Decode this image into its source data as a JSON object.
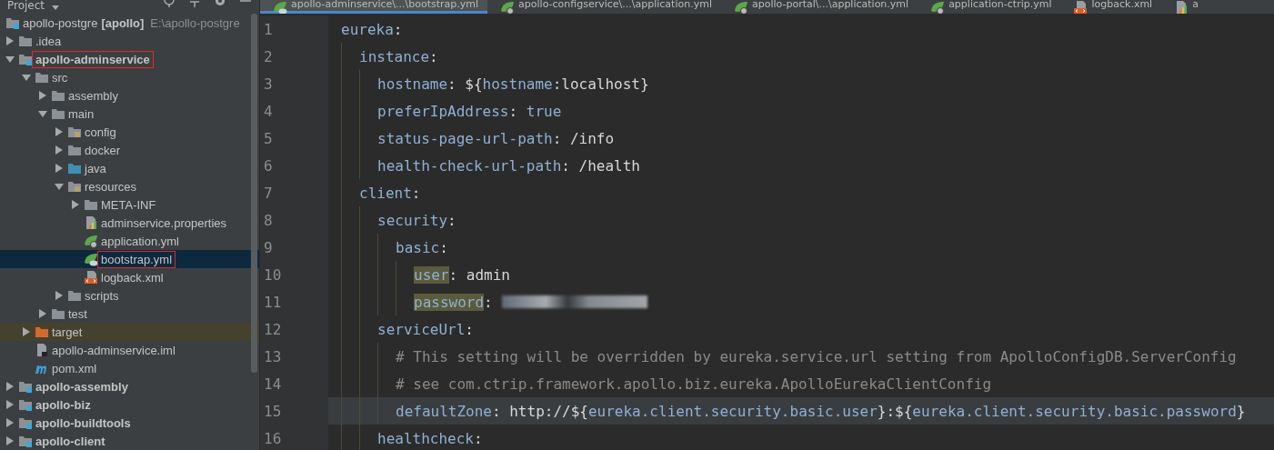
{
  "project_panel": {
    "title": "Project",
    "root": {
      "label": "apollo-postgre",
      "module": "[apollo]",
      "path": "E:\\apollo-postgre",
      "kind": "project",
      "selected": false,
      "marked": false,
      "children": [
        {
          "label": ".idea",
          "kind": "folder",
          "expanded": false,
          "selected": false,
          "marked": false
        },
        {
          "label": "apollo-adminservice",
          "kind": "module",
          "expanded": true,
          "selected": false,
          "marked": true,
          "children": [
            {
              "label": "src",
              "kind": "folder",
              "expanded": true,
              "selected": false,
              "marked": false,
              "children": [
                {
                  "label": "assembly",
                  "kind": "folder",
                  "expanded": false,
                  "selected": false,
                  "marked": false
                },
                {
                  "label": "main",
                  "kind": "folder",
                  "expanded": true,
                  "selected": false,
                  "marked": false,
                  "children": [
                    {
                      "label": "config",
                      "kind": "resource-folder",
                      "expanded": false,
                      "selected": false,
                      "marked": false
                    },
                    {
                      "label": "docker",
                      "kind": "folder",
                      "expanded": false,
                      "selected": false,
                      "marked": false
                    },
                    {
                      "label": "java",
                      "kind": "source-folder",
                      "expanded": false,
                      "selected": false,
                      "marked": false
                    },
                    {
                      "label": "resources",
                      "kind": "resource-folder",
                      "expanded": true,
                      "selected": false,
                      "marked": false,
                      "children": [
                        {
                          "label": "META-INF",
                          "kind": "folder",
                          "expanded": false,
                          "selected": false,
                          "marked": false
                        },
                        {
                          "label": "adminservice.properties",
                          "kind": "properties-file",
                          "selected": false,
                          "marked": false
                        },
                        {
                          "label": "application.yml",
                          "kind": "spring-file",
                          "selected": false,
                          "marked": false
                        },
                        {
                          "label": "bootstrap.yml",
                          "kind": "spring-cloud-file",
                          "selected": true,
                          "marked": true
                        },
                        {
                          "label": "logback.xml",
                          "kind": "xml-file",
                          "selected": false,
                          "marked": false
                        }
                      ]
                    },
                    {
                      "label": "scripts",
                      "kind": "folder",
                      "expanded": false,
                      "selected": false,
                      "marked": false
                    }
                  ]
                },
                {
                  "label": "test",
                  "kind": "folder",
                  "expanded": false,
                  "selected": false,
                  "marked": false
                }
              ]
            },
            {
              "label": "target",
              "kind": "excluded-folder",
              "expanded": false,
              "selected": false,
              "marked": false
            },
            {
              "label": "apollo-adminservice.iml",
              "kind": "iml-file",
              "selected": false,
              "marked": false
            },
            {
              "label": "pom.xml",
              "kind": "maven-file",
              "selected": false,
              "marked": false
            }
          ]
        },
        {
          "label": "apollo-assembly",
          "kind": "module",
          "expanded": false,
          "selected": false,
          "marked": false
        },
        {
          "label": "apollo-biz",
          "kind": "module",
          "expanded": false,
          "selected": false,
          "marked": false
        },
        {
          "label": "apollo-buildtools",
          "kind": "module",
          "expanded": false,
          "selected": false,
          "marked": false
        },
        {
          "label": "apollo-client",
          "kind": "module",
          "expanded": false,
          "selected": false,
          "marked": false
        }
      ]
    }
  },
  "tabs": [
    {
      "label": "apollo-adminservice\\...\\bootstrap.yml",
      "kind": "spring-cloud-file",
      "selected": true
    },
    {
      "label": "apollo-configservice\\...\\application.yml",
      "kind": "spring-file",
      "selected": false
    },
    {
      "label": "apollo-portal\\...\\application.yml",
      "kind": "spring-file",
      "selected": false
    },
    {
      "label": "application-ctrip.yml",
      "kind": "spring-file",
      "selected": false
    },
    {
      "label": "logback.xml",
      "kind": "xml-file",
      "selected": false
    },
    {
      "label": "a",
      "kind": "properties-file",
      "selected": false
    }
  ],
  "editor": {
    "lines": [
      {
        "number": "1",
        "current": false,
        "segments": [
          {
            "kind": "key",
            "text": "eureka"
          },
          {
            "kind": "plain",
            "text": ":"
          }
        ],
        "children": [
          {
            "number": "2",
            "current": false,
            "segments": [
              {
                "kind": "key",
                "text": "instance"
              },
              {
                "kind": "plain",
                "text": ":"
              }
            ],
            "children": [
              {
                "number": "3",
                "current": false,
                "segments": [
                  {
                    "kind": "key",
                    "text": "hostname"
                  },
                  {
                    "kind": "plain",
                    "text": ": ${"
                  },
                  {
                    "kind": "var",
                    "text": "hostname"
                  },
                  {
                    "kind": "plain",
                    "text": ":localhost}"
                  }
                ]
              },
              {
                "number": "4",
                "current": false,
                "segments": [
                  {
                    "kind": "key",
                    "text": "preferIpAddress"
                  },
                  {
                    "kind": "plain",
                    "text": ": "
                  },
                  {
                    "kind": "var",
                    "text": "true"
                  }
                ]
              },
              {
                "number": "5",
                "current": false,
                "segments": [
                  {
                    "kind": "key",
                    "text": "status-page-url-path"
                  },
                  {
                    "kind": "plain",
                    "text": ": /info"
                  }
                ]
              },
              {
                "number": "6",
                "current": false,
                "segments": [
                  {
                    "kind": "key",
                    "text": "health-check-url-path"
                  },
                  {
                    "kind": "plain",
                    "text": ": /health"
                  }
                ]
              }
            ]
          },
          {
            "number": "7",
            "current": false,
            "segments": [
              {
                "kind": "key",
                "text": "client"
              },
              {
                "kind": "plain",
                "text": ":"
              }
            ],
            "children": [
              {
                "number": "8",
                "current": false,
                "segments": [
                  {
                    "kind": "key",
                    "text": "security"
                  },
                  {
                    "kind": "plain",
                    "text": ":"
                  }
                ],
                "children": [
                  {
                    "number": "9",
                    "current": false,
                    "segments": [
                      {
                        "kind": "key",
                        "text": "basic"
                      },
                      {
                        "kind": "plain",
                        "text": ":"
                      }
                    ],
                    "children": [
                      {
                        "number": "10",
                        "current": false,
                        "segments": [
                          {
                            "kind": "highlighted-key",
                            "text": "user"
                          },
                          {
                            "kind": "plain",
                            "text": ": admin"
                          }
                        ]
                      },
                      {
                        "number": "11",
                        "current": false,
                        "segments": [
                          {
                            "kind": "highlighted-key",
                            "text": "password"
                          },
                          {
                            "kind": "plain",
                            "text": ":"
                          },
                          {
                            "kind": "blurred"
                          }
                        ]
                      }
                    ]
                  }
                ]
              },
              {
                "number": "12",
                "current": false,
                "segments": [
                  {
                    "kind": "key",
                    "text": "serviceUrl"
                  },
                  {
                    "kind": "plain",
                    "text": ":"
                  }
                ],
                "children": [
                  {
                    "number": "13",
                    "current": false,
                    "segments": [
                      {
                        "kind": "comment",
                        "text": "# This setting will be overridden by eureka.service.url setting from ApolloConfigDB.ServerConfig"
                      }
                    ]
                  },
                  {
                    "number": "14",
                    "current": false,
                    "segments": [
                      {
                        "kind": "comment",
                        "text": "# see com.ctrip.framework.apollo.biz.eureka.ApolloEurekaClientConfig"
                      }
                    ]
                  },
                  {
                    "number": "15",
                    "current": true,
                    "segments": [
                      {
                        "kind": "key",
                        "text": "defaultZone"
                      },
                      {
                        "kind": "plain",
                        "text": ": http://${"
                      },
                      {
                        "kind": "var",
                        "text": "eureka.client.security.basic.user"
                      },
                      {
                        "kind": "plain",
                        "text": "}:${"
                      },
                      {
                        "kind": "var",
                        "text": "eureka.client.security.basic.password"
                      },
                      {
                        "kind": "plain",
                        "text": "}"
                      }
                    ]
                  }
                ]
              },
              {
                "number": "16",
                "current": false,
                "segments": [
                  {
                    "kind": "key",
                    "text": "healthcheck"
                  },
                  {
                    "kind": "plain",
                    "text": ":"
                  }
                ]
              }
            ]
          }
        ]
      }
    ]
  }
}
